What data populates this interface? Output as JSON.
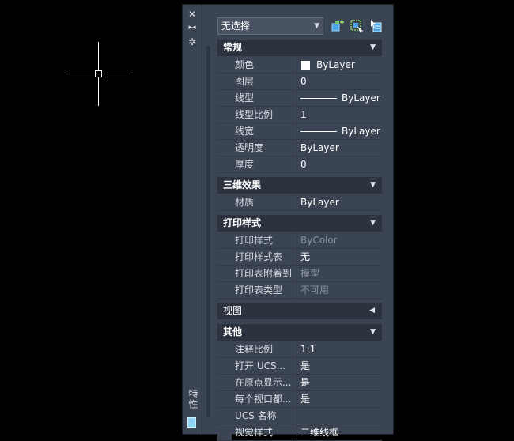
{
  "palette": {
    "title": "特性",
    "selector": {
      "value": "无选择"
    },
    "icons": [
      "close-icon",
      "autohide-icon",
      "settings-icon",
      "quick-select-icon",
      "select-objects-icon",
      "toggle-pickadd-icon",
      "calculator-icon"
    ]
  },
  "categories": {
    "general": {
      "label": "常规",
      "rows": [
        {
          "key": "颜色",
          "value": "ByLayer"
        },
        {
          "key": "图层",
          "value": "0"
        },
        {
          "key": "线型",
          "value": "ByLayer"
        },
        {
          "key": "线型比例",
          "value": "1"
        },
        {
          "key": "线宽",
          "value": "ByLayer"
        },
        {
          "key": "透明度",
          "value": "ByLayer"
        },
        {
          "key": "厚度",
          "value": "0"
        }
      ]
    },
    "threed": {
      "label": "三维效果",
      "rows": [
        {
          "key": "材质",
          "value": "ByLayer"
        }
      ]
    },
    "plot": {
      "label": "打印样式",
      "rows": [
        {
          "key": "打印样式",
          "value": "ByColor"
        },
        {
          "key": "打印样式表",
          "value": "无"
        },
        {
          "key": "打印表附着到",
          "value": "模型"
        },
        {
          "key": "打印表类型",
          "value": "不可用"
        }
      ]
    },
    "view": {
      "label": "视图"
    },
    "misc": {
      "label": "其他",
      "rows": [
        {
          "key": "注释比例",
          "value": "1:1"
        },
        {
          "key": "打开 UCS...",
          "value": "是"
        },
        {
          "key": "在原点显示...",
          "value": "是"
        },
        {
          "key": "每个视口都...",
          "value": "是"
        },
        {
          "key": "UCS 名称",
          "value": ""
        },
        {
          "key": "视觉样式",
          "value": "二维线框"
        }
      ]
    }
  }
}
